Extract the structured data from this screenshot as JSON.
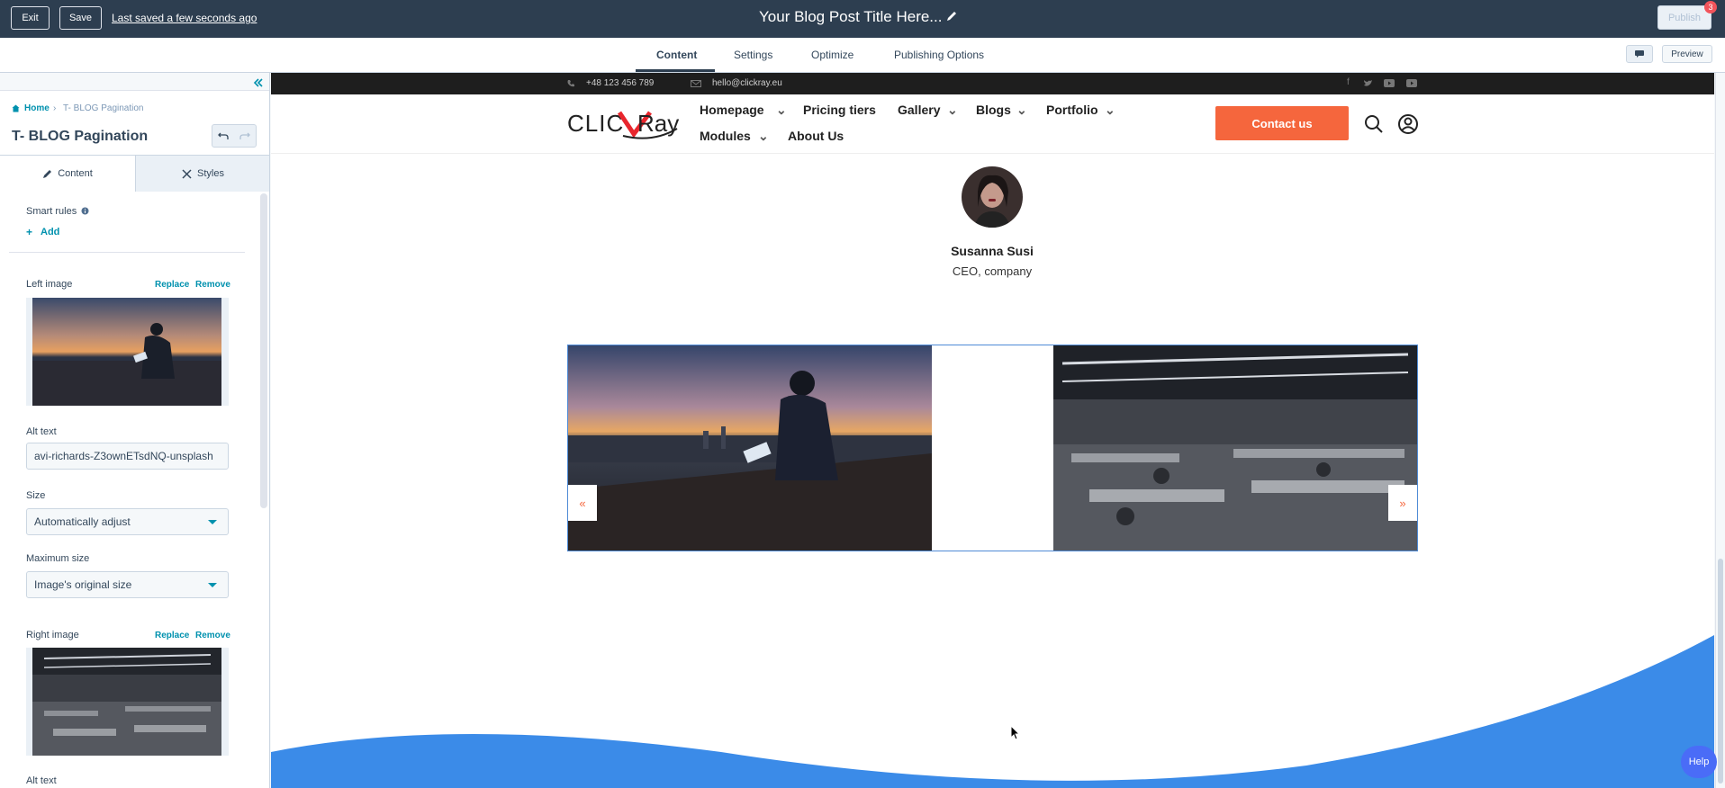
{
  "topbar": {
    "exit_label": "Exit",
    "save_label": "Save",
    "saved_status": "Last saved a few seconds ago",
    "post_title": "Your Blog Post Title Here...",
    "publish_label": "Publish",
    "notification_count": "3"
  },
  "tabs": [
    {
      "label": "Content"
    },
    {
      "label": "Settings"
    },
    {
      "label": "Optimize"
    },
    {
      "label": "Publishing Options"
    }
  ],
  "toolbar": {
    "preview_label": "Preview"
  },
  "sidebar": {
    "breadcrumb": {
      "home": "Home",
      "current": "T- BLOG Pagination"
    },
    "module_title": "T- BLOG Pagination",
    "panel_tabs": {
      "content": "Content",
      "styles": "Styles"
    },
    "smart_rules_label": "Smart rules",
    "add_label": "Add",
    "left_image": {
      "label": "Left image",
      "replace": "Replace",
      "remove": "Remove"
    },
    "alt_text_label": "Alt text",
    "alt_text_value": "avi-richards-Z3ownETsdNQ-unsplash",
    "size_label": "Size",
    "size_value": "Automatically adjust",
    "max_size_label": "Maximum size",
    "max_size_value": "Image's original size",
    "right_image": {
      "label": "Right image",
      "replace": "Replace",
      "remove": "Remove"
    },
    "alt_text_label_2": "Alt text"
  },
  "site": {
    "phone": "+48 123 456 789",
    "email": "hello@clickray.eu",
    "logo_text": "CLICKRay",
    "nav": [
      {
        "label": "Homepage"
      },
      {
        "label": "Pricing tiers"
      },
      {
        "label": "Gallery"
      },
      {
        "label": "Blogs"
      },
      {
        "label": "Portfolio"
      },
      {
        "label": "Modules"
      },
      {
        "label": "About Us"
      }
    ],
    "contact_label": "Contact us",
    "person_name": "Susanna Susi",
    "person_role": "CEO, company",
    "prev_arrow": "«",
    "next_arrow": "»"
  },
  "help_label": "Help",
  "colors": {
    "topbar": "#2d3e50",
    "accent_orange": "#f5663d",
    "wave_blue": "#3b8be8",
    "link_teal": "#0091ae"
  }
}
